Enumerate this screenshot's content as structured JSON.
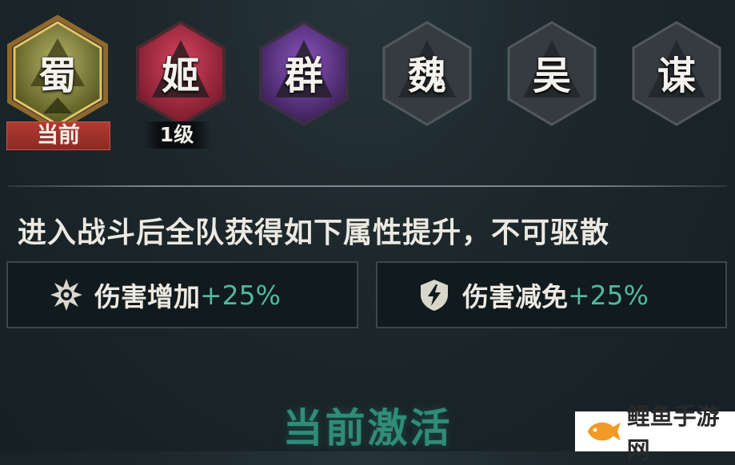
{
  "factions": [
    {
      "label": "蜀",
      "state": "current",
      "tag": "当前",
      "color": "#8b8f45"
    },
    {
      "label": "姬",
      "state": "unlocked",
      "tag": "1级",
      "color": "#c02c44"
    },
    {
      "label": "群",
      "state": "unlocked",
      "tag": "",
      "color": "#6b3c9a"
    },
    {
      "label": "魏",
      "state": "locked",
      "tag": "",
      "color": "#3a4044"
    },
    {
      "label": "吴",
      "state": "locked",
      "tag": "",
      "color": "#3a4044"
    },
    {
      "label": "谋",
      "state": "locked",
      "tag": "",
      "color": "#3a4044"
    }
  ],
  "description": "进入战斗后全队获得如下属性提升，不可驱散",
  "stats": [
    {
      "icon": "burst-icon",
      "name": "伤害增加",
      "value": "+25%"
    },
    {
      "icon": "shield-lightning-icon",
      "name": "伤害减免",
      "value": "+25%"
    }
  ],
  "active_title": "当前激活",
  "watermark": {
    "text": "鲤鱼手游网",
    "icon": "fish-logo-icon"
  },
  "colors": {
    "accent": "#4fb9a0",
    "current_tag": "#a8332c",
    "glow": "#f0a030"
  }
}
